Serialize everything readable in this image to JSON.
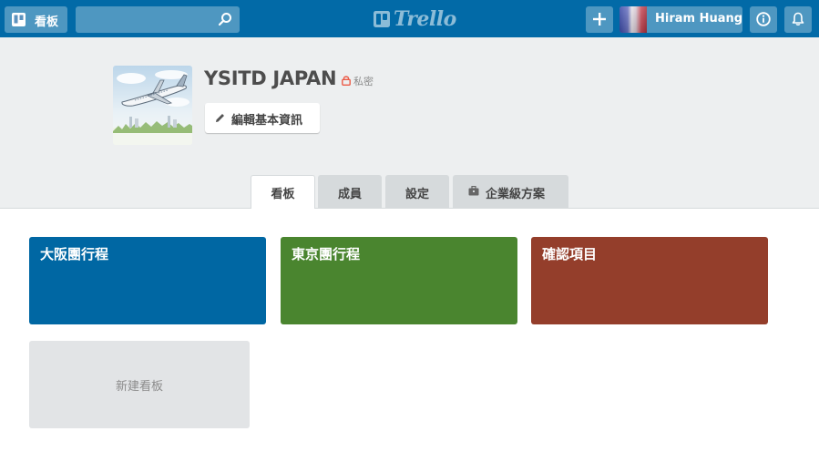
{
  "header": {
    "boards_label": "看板",
    "search_placeholder": "",
    "logo_text": "Trello",
    "user_name": "Hiram Huang"
  },
  "org": {
    "name": "YSITD JAPAN",
    "visibility": "私密",
    "edit_label": "編輯基本資訊"
  },
  "tabs": [
    {
      "label": "看板",
      "active": true
    },
    {
      "label": "成員",
      "active": false
    },
    {
      "label": "設定",
      "active": false
    },
    {
      "label": "企業級方案",
      "active": false
    }
  ],
  "boards": [
    {
      "title": "大阪團行程",
      "color": "#0067a3"
    },
    {
      "title": "東京團行程",
      "color": "#4a852f"
    },
    {
      "title": "確認項目",
      "color": "#943e2b"
    }
  ],
  "new_board_label": "新建看板",
  "colors": {
    "header": "#026aa7",
    "org_background": "#edeff0",
    "private_icon": "#eb5a46"
  }
}
